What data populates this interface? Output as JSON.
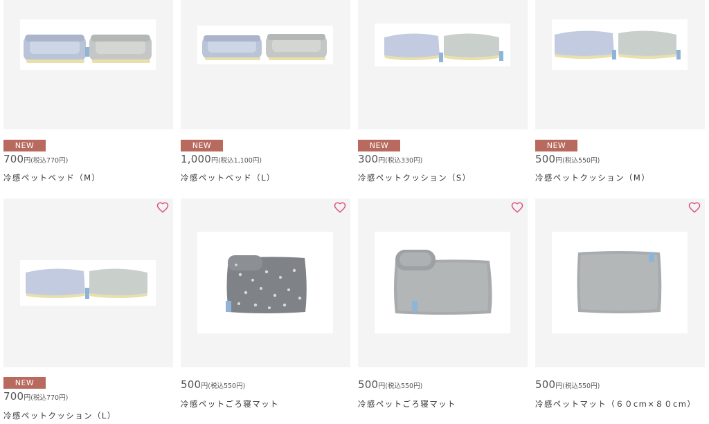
{
  "colors": {
    "badge": "#b86a5f",
    "heart": "#d94f86",
    "image_bg": "#f5f4f4"
  },
  "products": [
    {
      "badge": "NEW",
      "price": "700",
      "price_unit": "円",
      "tax_price": "(税込770円)",
      "name": "冷感ペットベッド（M）",
      "image": "pet-bed-pair-photo",
      "favorite_icon": false
    },
    {
      "badge": "NEW",
      "price": "1,000",
      "price_unit": "円",
      "tax_price": "(税込1,100円)",
      "name": "冷感ペットベッド（L）",
      "image": "pet-bed-pair-photo",
      "favorite_icon": false
    },
    {
      "badge": "NEW",
      "price": "300",
      "price_unit": "円",
      "tax_price": "(税込330円)",
      "name": "冷感ペットクッション（S）",
      "image": "pet-cushion-pair-photo",
      "favorite_icon": false
    },
    {
      "badge": "NEW",
      "price": "500",
      "price_unit": "円",
      "tax_price": "(税込550円)",
      "name": "冷感ペットクッション（M）",
      "image": "pet-cushion-pair-photo",
      "favorite_icon": false
    },
    {
      "badge": "NEW",
      "price": "700",
      "price_unit": "円",
      "tax_price": "(税込770円)",
      "name": "冷感ペットクッション（L）",
      "image": "pet-cushion-pair-photo",
      "favorite_icon": true
    },
    {
      "badge": "",
      "price": "500",
      "price_unit": "円",
      "tax_price": "(税込550円)",
      "name": "冷感ペットごろ寝マット",
      "image": "patterned-mat-with-pillow-photo",
      "favorite_icon": true
    },
    {
      "badge": "",
      "price": "500",
      "price_unit": "円",
      "tax_price": "(税込550円)",
      "name": "冷感ペットごろ寝マット",
      "image": "gray-mat-with-pillow-photo",
      "favorite_icon": true
    },
    {
      "badge": "",
      "price": "500",
      "price_unit": "円",
      "tax_price": "(税込550円)",
      "name": "冷感ペットマット（６０cm×８０cm）",
      "image": "gray-mat-photo",
      "favorite_icon": true
    }
  ]
}
